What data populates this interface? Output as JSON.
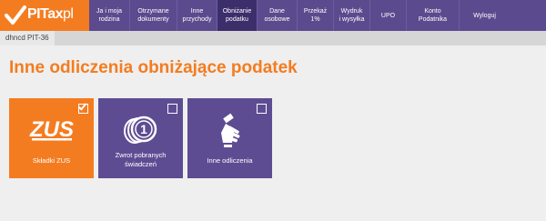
{
  "logo": {
    "brand": "PITax",
    "suffix": "pl"
  },
  "nav": [
    {
      "label": "Ja i moja\nrodzina",
      "width": 44,
      "active": false
    },
    {
      "label": "Otrzymane\ndokumenty",
      "width": 52,
      "active": false
    },
    {
      "label": "Inne\nprzychody",
      "width": 44,
      "active": false
    },
    {
      "label": "Obniżanie\npodatku",
      "width": 44,
      "active": true
    },
    {
      "label": "Dane\nosobowe",
      "width": 44,
      "active": false
    },
    {
      "label": "Przekaż\n1%",
      "width": 40,
      "active": false
    },
    {
      "label": "Wydruk\ni wysyłka",
      "width": 40,
      "active": false
    },
    {
      "label": "UPO",
      "width": 40,
      "active": false
    },
    {
      "label": "Konto\nPodatnika",
      "width": 58,
      "active": false
    },
    {
      "label": "Wyloguj",
      "width": 56,
      "active": false
    }
  ],
  "breadcrumb": "dhncd PIT-36",
  "page_title": "Inne odliczenia obniżające podatek",
  "tiles": [
    {
      "label": "Składki ZUS",
      "checked": true,
      "icon": "zus-logo-icon",
      "icon_text": "ZUS",
      "color": "#f47c20"
    },
    {
      "label": "Zwrot pobranych\nświadczeń",
      "checked": false,
      "icon": "coins-icon",
      "icon_text": "1",
      "color": "#5e4c93"
    },
    {
      "label": "Inne odliczenia",
      "checked": false,
      "icon": "hand-pointer-icon",
      "color": "#5e4c93"
    }
  ],
  "colors": {
    "accent": "#f47c20",
    "nav_bg": "#5c4a8e",
    "nav_active": "#3c2e6b",
    "tile_purple": "#5e4c93"
  }
}
